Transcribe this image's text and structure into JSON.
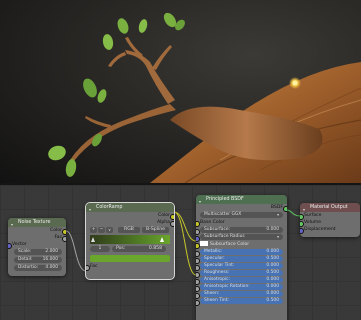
{
  "nodes": {
    "noise": {
      "title": "Noise Texture",
      "out_color": "Color",
      "out_fac": "Fac",
      "in_vector": "Vector",
      "fields": [
        {
          "label": "Scale:",
          "value": "2.000"
        },
        {
          "label": "Detail:",
          "value": "16.000"
        },
        {
          "label": "Distortio:",
          "value": "4.000"
        }
      ]
    },
    "ramp": {
      "title": "ColorRamp",
      "out_color": "Color",
      "out_alpha": "Alpha",
      "btn_add": "+",
      "btn_remove": "−",
      "btn_menu": "∨",
      "mode": "RGB",
      "interp": "B-Spline",
      "index": "1",
      "pos_label": "Pos:",
      "pos_value": "0.858",
      "in_fac": "Fac"
    },
    "bsdf": {
      "title": "Principled BSDF",
      "out_bsdf": "BSDF",
      "distribution": "Multiscatter GGX",
      "base_color": "Base Color",
      "subsurface_label": "Subsurface:",
      "subsurface_value": "0.000",
      "subsurface_radius": "Subsurface Radius",
      "subsurface_color": "Subsurface Color",
      "params": [
        {
          "label": "Metallic:",
          "value": "0.000"
        },
        {
          "label": "Specular:",
          "value": "0.500"
        },
        {
          "label": "Specular Tint:",
          "value": "0.000"
        },
        {
          "label": "Roughness:",
          "value": "0.500"
        },
        {
          "label": "Anisotropic:",
          "value": "0.000"
        },
        {
          "label": "Anisotropic Rotation:",
          "value": "0.000"
        },
        {
          "label": "Sheen:",
          "value": "0.000"
        },
        {
          "label": "Sheen Tint:",
          "value": "0.500"
        }
      ]
    },
    "output": {
      "title": "Material Output",
      "inputs": [
        "Surface",
        "Volume",
        "Displacement"
      ]
    }
  },
  "colors": {
    "editor_bg": "#393939",
    "node_body": "#6e6e6e",
    "socket_yellow": "#c7c729",
    "socket_grey": "#a1a1a1",
    "socket_purple": "#6363c7",
    "socket_green": "#63c763",
    "ramp_gradient_start": "#2f3a1a",
    "ramp_gradient_end": "#6aa52c"
  }
}
